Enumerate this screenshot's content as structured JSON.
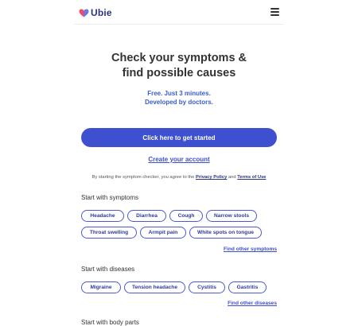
{
  "header": {
    "logo_text": "Ubie",
    "brand_colors": [
      "#ef4b6c",
      "#6a79e6"
    ],
    "menu_icon": "hamburger-menu-icon"
  },
  "hero": {
    "title_line1": "Check your symptoms &",
    "title_line2": "find possible causes",
    "subtitle_line1": "Free. Just 3 minutes.",
    "subtitle_line2": "Developed by doctors."
  },
  "cta": {
    "label": "Click here to get started",
    "color": "#3e4fd0"
  },
  "account": {
    "create_label": "Create your account"
  },
  "terms": {
    "prefix": "By starting the symptom checker, you agree to the",
    "privacy": "Privacy Policy",
    "and": "and",
    "terms_of_use": "Terms of Use"
  },
  "symptoms": {
    "title": "Start with symptoms",
    "chips": [
      "Headache",
      "Diarrhea",
      "Cough",
      "Narrow stools",
      "Throat swelling",
      "Armpit pain",
      "White spots on tongue"
    ],
    "find_other": "Find other symptoms"
  },
  "diseases": {
    "title": "Start with diseases",
    "chips": [
      "Migraine",
      "Tension headache",
      "Cystitis",
      "Gastritis"
    ],
    "find_other": "Find other diseases"
  },
  "next_section": {
    "title": "Start with body parts"
  }
}
